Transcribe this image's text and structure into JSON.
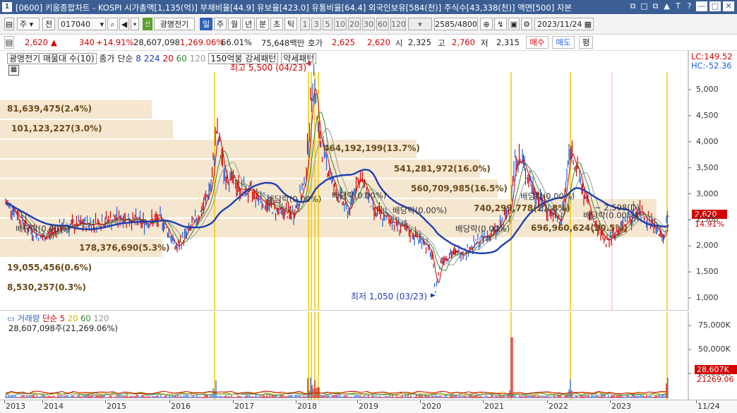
{
  "window": {
    "number": "1",
    "title": "[0600] 키움종합차트 - KOSPI 시가총액[1,135(억)] 부채비율[44.9] 유보율[423.0] 유통비율[64.4] 외국인보유[584(천)] 주식수[43,338(천)] 액면[500] 자본",
    "controls": [
      "⧉",
      "□",
      "⧉",
      "▲",
      "T",
      "?",
      "—",
      "□",
      "✕"
    ]
  },
  "toolbar": {
    "market": "주",
    "prev": "전",
    "code": "017040",
    "name_badge": "신",
    "name": "광명전기",
    "periods": [
      "일",
      "주",
      "월",
      "년",
      "분",
      "초",
      "틱"
    ],
    "minutes": [
      "1",
      "3",
      "5",
      "10",
      "20",
      "30",
      "60",
      "120"
    ],
    "count": "2585",
    "count_total": "/4800",
    "date": "2023/11/24"
  },
  "quote": {
    "price": "2,620",
    "change": "340",
    "change_pct": "+14.91%",
    "volume": "28,607,098",
    "vol_pct": "1,269.06%",
    "turnover": "66.01%",
    "amount": "75,648백만",
    "ask_label": "호가",
    "ask": "2,625",
    "bid": "2,620",
    "open_label": "시",
    "open": "2,325",
    "high_label": "고",
    "high": "2,760",
    "low_label": "저",
    "low": "2,315",
    "buy": "매수",
    "sell": "매도",
    "eval": "평"
  },
  "price_panel": {
    "title": "광명전기 매물대 수(10)",
    "ma_label": "종가 단순",
    "ma_periods": [
      "8",
      "224",
      "20",
      "60",
      "120"
    ],
    "ma_colors": [
      "#1f3fb0",
      "#1f3fb0",
      "#d40000",
      "#2e8b2e",
      "#999999"
    ],
    "pattern1": "150억봉 강세패턴",
    "pattern2": "약세패턴",
    "high_note": "최고 5,500 (04/23)",
    "low_note": "최저 1,050 (03/23)",
    "lc": "LC:149.52",
    "hc": "HC:-52.36",
    "last_price": "2,620",
    "last_pct": "14.91%",
    "profile_labels": [
      "81,639,475(2.4%)",
      "101,123,227(3.0%)",
      "464,192,199(13.7%)",
      "541,281,972(16.0%)",
      "560,709,985(16.5%)",
      "740,299,778(21.8%)",
      "696,960,624(20.5%)",
      "178,376,690(5.3%)",
      "19,055,456(0.6%)",
      "8,530,257(0.3%)"
    ],
    "dividend_labels": [
      "배당락(0.00%)",
      "배당락(0.00%)",
      "배당락(0.00%)",
      "배당락(0.00%)",
      "배당락(0.00%)",
      "배당락(0.00%)",
      "배당락(0.00%)",
      "배당락(0.00%)"
    ],
    "range_note": "~ 2,598(D)",
    "y_ticks": [
      "5,000",
      "4,500",
      "4,000",
      "3,500",
      "3,000",
      "2,500",
      "2,000",
      "1,500",
      "1,000"
    ]
  },
  "volume_panel": {
    "title": "거래량",
    "ma_label": "단순",
    "ma_periods": [
      "5",
      "20",
      "60",
      "120"
    ],
    "ma_colors": [
      "#d40000",
      "#d4b000",
      "#2e8b2e",
      "#999999"
    ],
    "current": "28,607,098주(21,269.06%)",
    "y_ticks": [
      "75,000K",
      "50,000K",
      "25,000K"
    ],
    "last_vol": "28,607K",
    "last_pct": "21269.06"
  },
  "x_axis": [
    "2013",
    "2014",
    "2015",
    "2016",
    "2017",
    "2018",
    "2019",
    "2020",
    "2021",
    "2022",
    "2023",
    "11/24"
  ],
  "colors": {
    "up": "#d40000",
    "down": "#1f5fe0",
    "profile": "#f5e6cf",
    "vline": "#f0c800",
    "pink": "#ff9de0"
  }
}
